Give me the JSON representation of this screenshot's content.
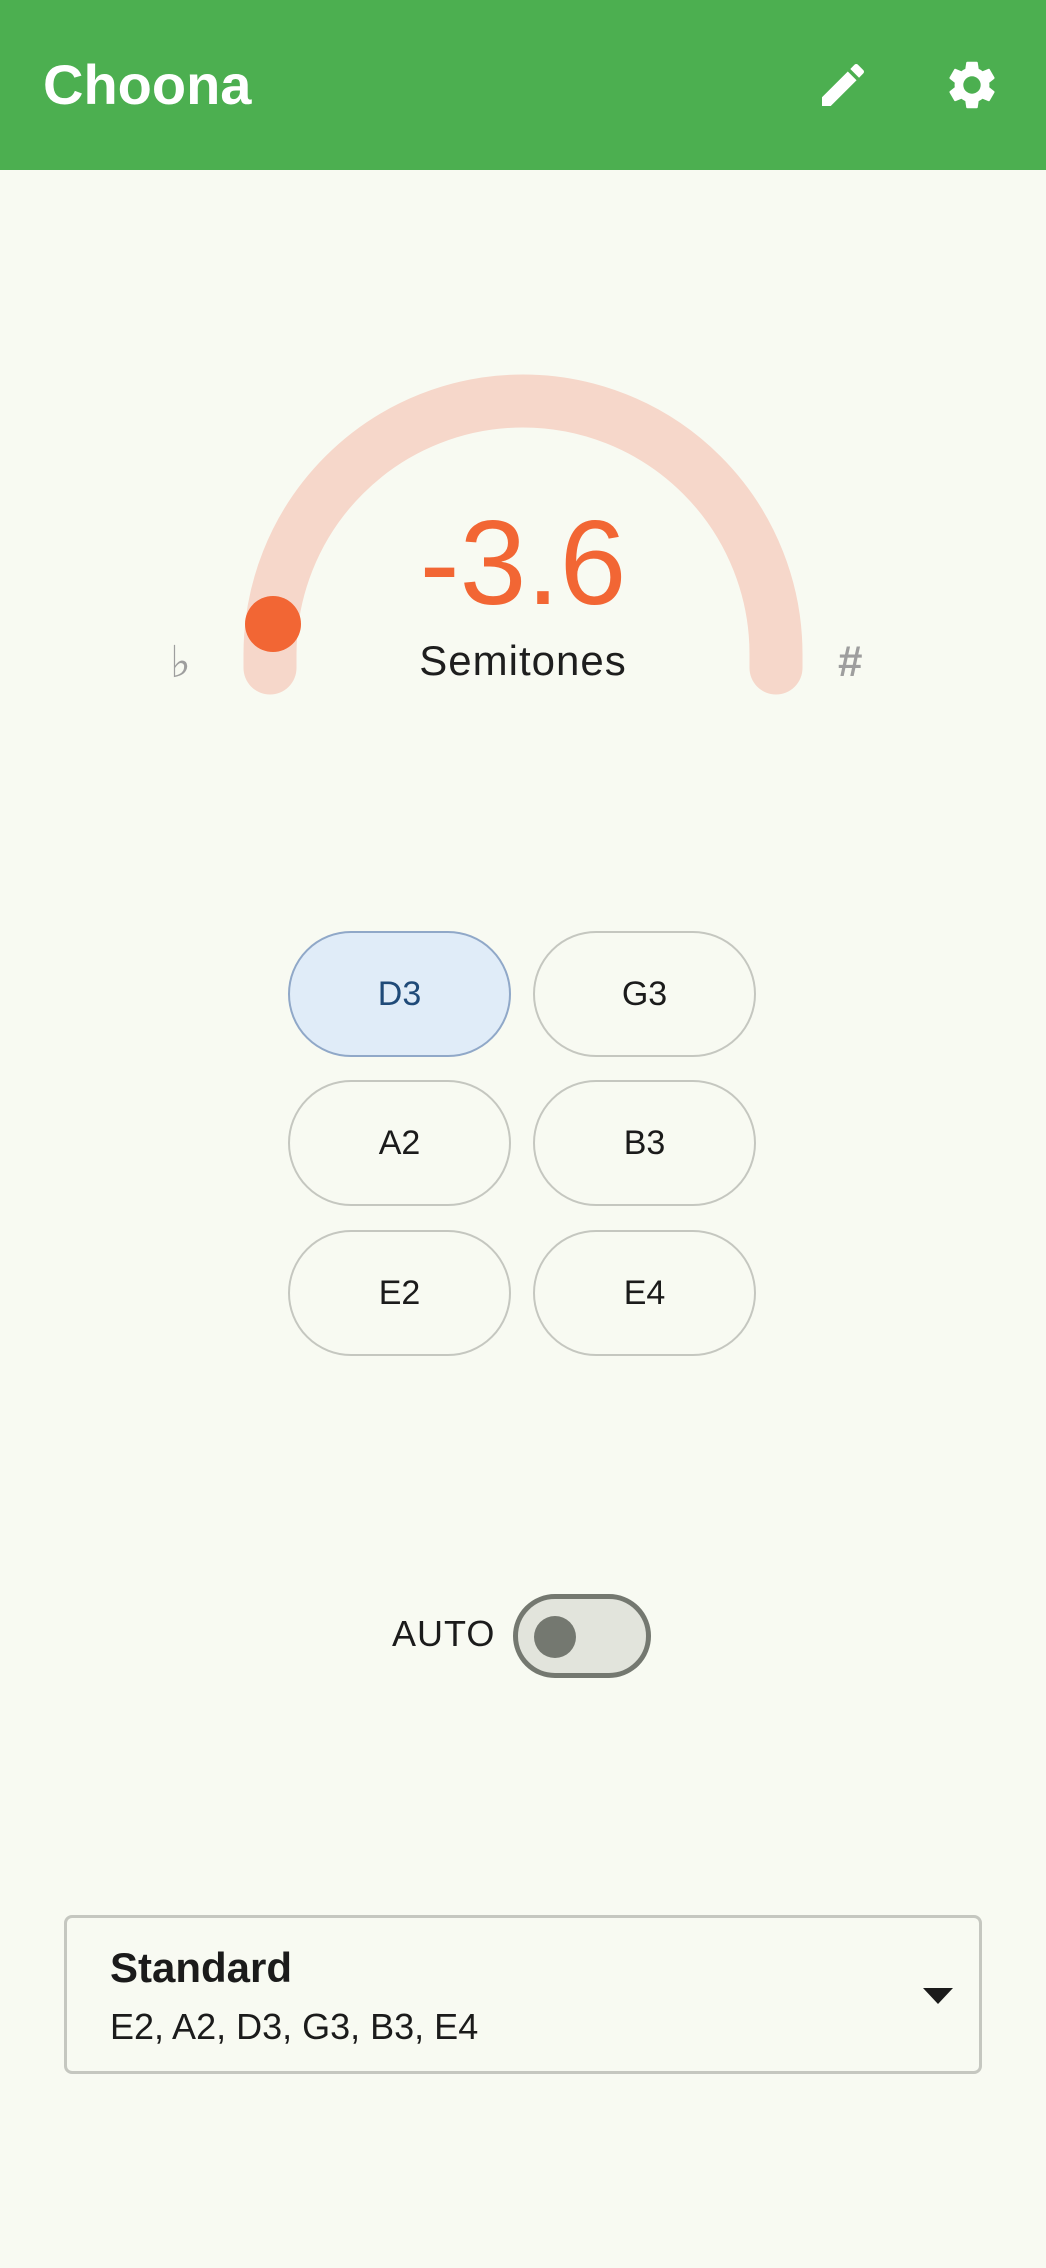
{
  "app": {
    "title": "Choona",
    "accent_color": "#4caf50",
    "edit_icon": "pencil-icon",
    "settings_icon": "gear-icon"
  },
  "tuner": {
    "value": "-3.6",
    "unit": "Semitones",
    "flat_symbol": "♭",
    "sharp_symbol": "#",
    "indicator_color": "#f26634",
    "track_color": "#f6d7ca",
    "indicator_fraction": 0.0
  },
  "strings": [
    {
      "label": "D3",
      "selected": true
    },
    {
      "label": "G3",
      "selected": false
    },
    {
      "label": "A2",
      "selected": false
    },
    {
      "label": "B3",
      "selected": false
    },
    {
      "label": "E2",
      "selected": false
    },
    {
      "label": "E4",
      "selected": false
    }
  ],
  "auto": {
    "label": "AUTO",
    "enabled": false
  },
  "tuning": {
    "name": "Standard",
    "notes": "E2, A2, D3, G3, B3, E4",
    "dropdown_icon": "triangle-down-icon"
  }
}
